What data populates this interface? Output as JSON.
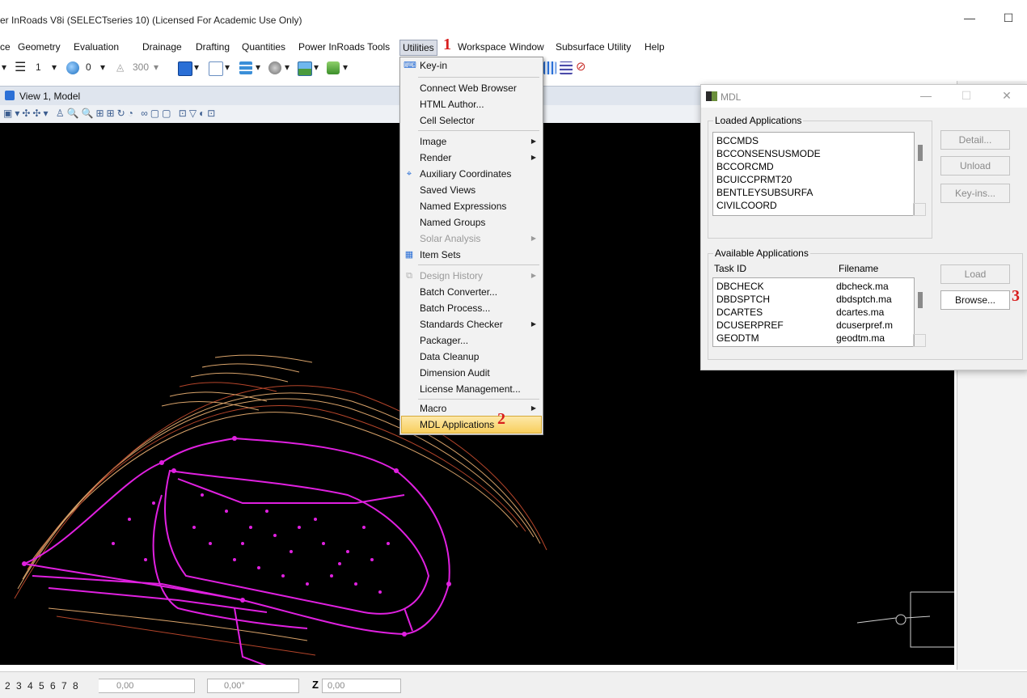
{
  "window": {
    "title": "er InRoads V8i (SELECTseries 10) (Licensed For Academic Use Only)",
    "minimize": "—",
    "maximize": "☐"
  },
  "menubar": {
    "items": [
      "ce",
      "Geometry",
      "Evaluation",
      "Drainage",
      "Drafting",
      "Quantities",
      "Power InRoads Tools",
      "Utilities",
      "Workspace",
      "Window",
      "Subsurface Utility",
      "Help"
    ],
    "open_item": "Utilities"
  },
  "annotations": {
    "step1": "1",
    "step2": "2",
    "step3": "3"
  },
  "toolbar": {
    "weight": "1",
    "color": "0",
    "scale": "300"
  },
  "view": {
    "title": "View 1, Model"
  },
  "utilities_menu": {
    "items": [
      {
        "label": "Key-in",
        "submenu": false,
        "disabled": false
      },
      {
        "label": "Connect Web Browser",
        "submenu": false,
        "disabled": false
      },
      {
        "label": "HTML Author...",
        "submenu": false,
        "disabled": false
      },
      {
        "label": "Cell Selector",
        "submenu": false,
        "disabled": false
      },
      {
        "label": "Image",
        "submenu": true,
        "disabled": false
      },
      {
        "label": "Render",
        "submenu": true,
        "disabled": false
      },
      {
        "label": "Auxiliary Coordinates",
        "submenu": false,
        "disabled": false
      },
      {
        "label": "Saved Views",
        "submenu": false,
        "disabled": false
      },
      {
        "label": "Named Expressions",
        "submenu": false,
        "disabled": false
      },
      {
        "label": "Named Groups",
        "submenu": false,
        "disabled": false
      },
      {
        "label": "Solar Analysis",
        "submenu": true,
        "disabled": true
      },
      {
        "label": "Item Sets",
        "submenu": false,
        "disabled": false
      },
      {
        "label": "Design History",
        "submenu": true,
        "disabled": true
      },
      {
        "label": "Batch Converter...",
        "submenu": false,
        "disabled": false
      },
      {
        "label": "Batch Process...",
        "submenu": false,
        "disabled": false
      },
      {
        "label": "Standards Checker",
        "submenu": true,
        "disabled": false
      },
      {
        "label": "Packager...",
        "submenu": false,
        "disabled": false
      },
      {
        "label": "Data Cleanup",
        "submenu": false,
        "disabled": false
      },
      {
        "label": "Dimension Audit",
        "submenu": false,
        "disabled": false
      },
      {
        "label": "License Management...",
        "submenu": false,
        "disabled": false
      },
      {
        "label": "Macro",
        "submenu": true,
        "disabled": false
      },
      {
        "label": "MDL Applications",
        "submenu": false,
        "disabled": false
      }
    ],
    "selected": "MDL Applications"
  },
  "mdl_dialog": {
    "title": "MDL",
    "close": "✕",
    "minimize": "—",
    "maximize": "☐",
    "loaded_label": "Loaded Applications",
    "loaded": [
      "BCCMDS",
      "BCCONSENSUSMODE",
      "BCCORCMD",
      "BCUICCPRMT20",
      "BENTLEYSUBSURFA",
      "CIVILCOORD"
    ],
    "available_label": "Available Applications",
    "col_task": "Task ID",
    "col_file": "Filename",
    "available": [
      {
        "task": "DBCHECK",
        "file": "dbcheck.ma"
      },
      {
        "task": "DBDSPTCH",
        "file": "dbdsptch.ma"
      },
      {
        "task": "DCARTES",
        "file": "dcartes.ma"
      },
      {
        "task": "DCUSERPREF",
        "file": "dcuserpref.m"
      },
      {
        "task": "GEODTM",
        "file": "geodtm.ma"
      }
    ],
    "buttons": {
      "detail": "Detail...",
      "unload": "Unload",
      "keyins": "Key-ins...",
      "load": "Load",
      "browse": "Browse..."
    }
  },
  "statusbar": {
    "view_tabs": [
      "2",
      "3",
      "4",
      "5",
      "6",
      "7",
      "8"
    ],
    "x_value": "0,00",
    "angle_value": "0,00°",
    "z_label": "Z",
    "z_value": "0,00"
  },
  "colors": {
    "accent_red": "#d81d1d",
    "contour_magenta": "#e020e0",
    "contour_brown": "#b5452a",
    "contour_tan": "#d9a36a"
  }
}
